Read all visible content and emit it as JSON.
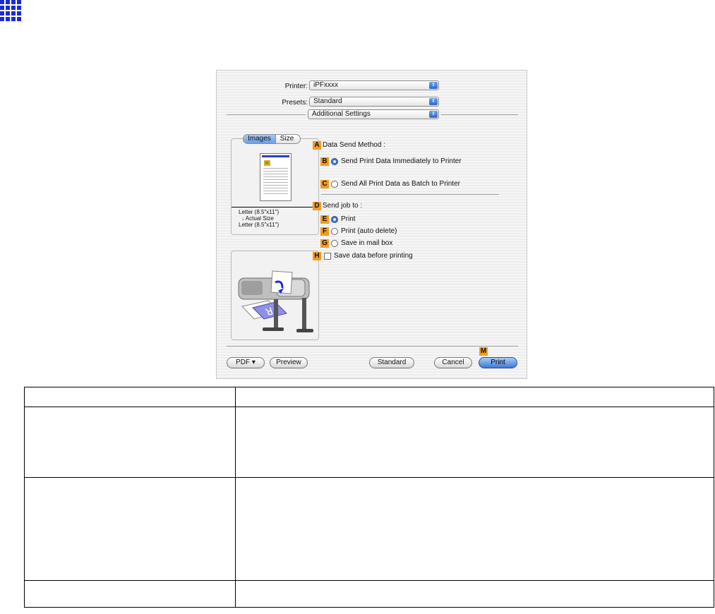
{
  "dialog": {
    "printer_label": "Printer:",
    "printer_value": "iPFxxxx",
    "presets_label": "Presets:",
    "presets_value": "Standard",
    "panel_value": "Additional Settings",
    "tabs": [
      "Images",
      "Size"
    ],
    "size_info": [
      "Letter (8.5\"x11\")",
      "Actual Size",
      "Letter (8.5\"x11\")"
    ],
    "data_send_method_label": "Data Send Method :",
    "send_immediately_label": "Send Print Data Immediately to Printer",
    "send_batch_label": "Send All Print Data as Batch to Printer",
    "send_job_to_label": "Send job to :",
    "print_label": "Print",
    "print_auto_delete_label": "Print (auto delete)",
    "save_in_mailbox_label": "Save in mail box",
    "save_before_printing_label": "Save data before printing",
    "buttons": {
      "pdf": "PDF ▾",
      "preview": "Preview",
      "standard": "Standard",
      "cancel": "Cancel",
      "print": "Print"
    },
    "badges": {
      "A": "A",
      "B": "B",
      "C": "C",
      "D": "D",
      "E": "E",
      "F": "F",
      "G": "G",
      "H": "H",
      "M": "M"
    }
  },
  "colors": {
    "accent": "#f39a21",
    "grid_icon": "#1b2bd6",
    "default_button": "#3f78d6"
  }
}
